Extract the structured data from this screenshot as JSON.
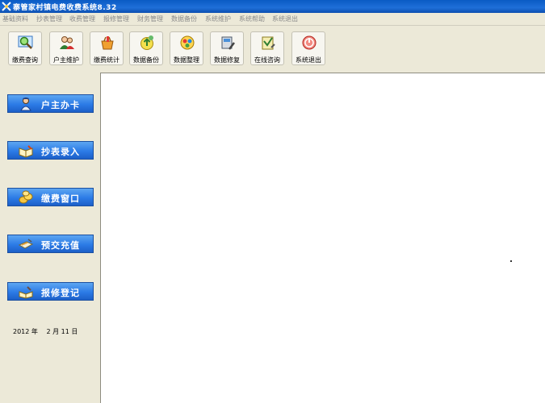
{
  "window": {
    "title": "寨管家村镇电费收费系统8.32",
    "app_icon": "crossed-tools-icon"
  },
  "menu": [
    "基础资料",
    "抄表管理",
    "收费管理",
    "报修管理",
    "财务管理",
    "数据备份",
    "系统维护",
    "系统帮助",
    "系统退出"
  ],
  "toolbar": [
    {
      "label": "缴费查询",
      "icon": "magnifier-icon"
    },
    {
      "label": "户主维护",
      "icon": "users-icon"
    },
    {
      "label": "缴费统计",
      "icon": "basket-icon"
    },
    {
      "label": "数据备份",
      "icon": "backup-icon"
    },
    {
      "label": "数据整理",
      "icon": "organize-icon"
    },
    {
      "label": "数据修复",
      "icon": "repair-icon"
    },
    {
      "label": "在线咨询",
      "icon": "consult-icon"
    },
    {
      "label": "系统退出",
      "icon": "power-icon"
    }
  ],
  "sidebar": [
    {
      "label": "户主办卡",
      "icon": "person-icon"
    },
    {
      "label": "抄表录入",
      "icon": "book-icon"
    },
    {
      "label": "缴费窗口",
      "icon": "coins-icon"
    },
    {
      "label": "预交充值",
      "icon": "card-icon"
    },
    {
      "label": "报修登记",
      "icon": "register-icon"
    }
  ],
  "date": "2012 年　 2 月 11 日",
  "colors": {
    "title_bar": "#0A5BC4",
    "sidebar_button": "#2C7BE6",
    "menu_text": "#8A8A8A",
    "background": "#ECE9D8"
  }
}
